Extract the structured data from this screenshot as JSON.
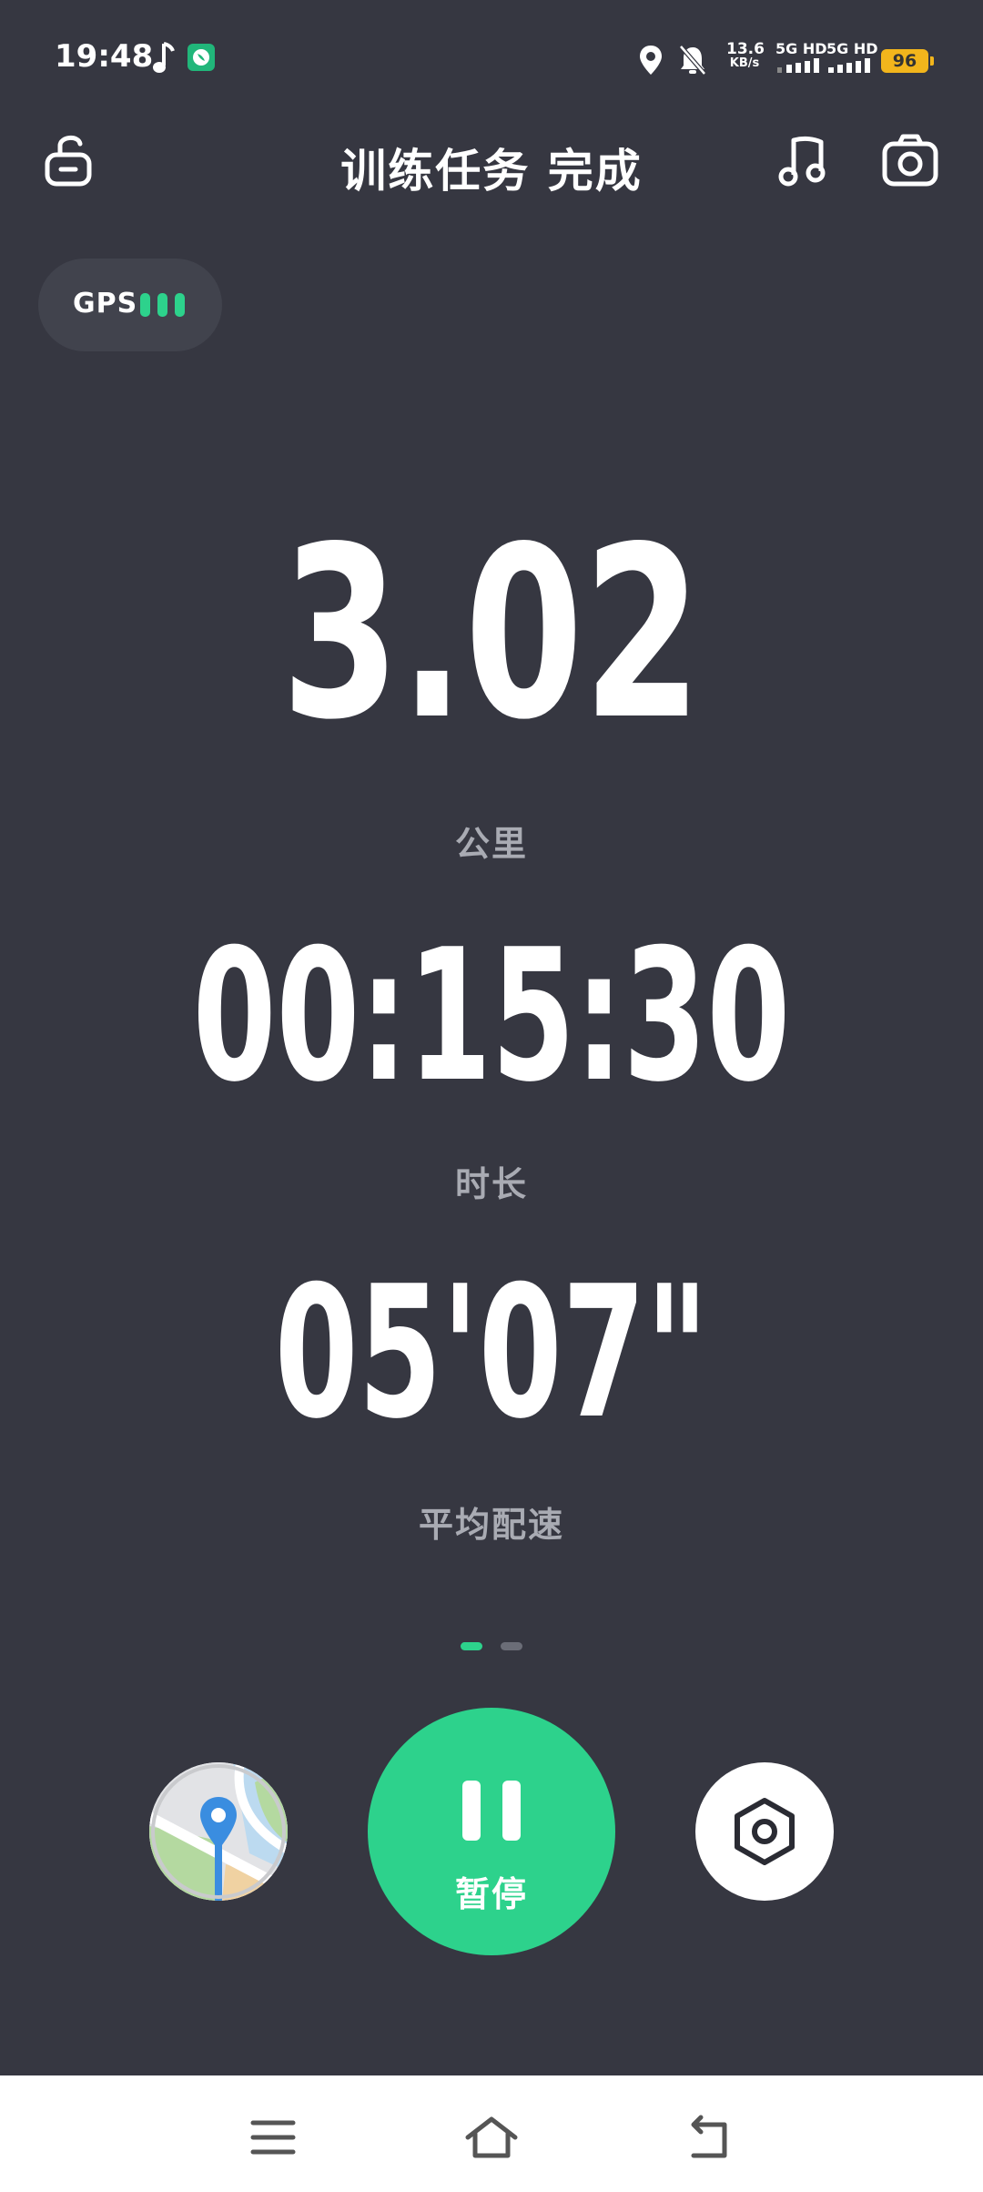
{
  "status_bar": {
    "time": "19:48",
    "net_speed_value": "13.6",
    "net_speed_unit": "KB/s",
    "sim1_label": "5G HD",
    "sim2_label": "5G HD",
    "battery_level": "96",
    "icons": [
      "music-note-icon",
      "app-notification-icon",
      "location-icon",
      "mute-bell-icon",
      "signal-icon",
      "signal-icon",
      "battery-icon"
    ]
  },
  "header": {
    "title": "训练任务 完成",
    "icons": [
      "unlock-icon",
      "music-icon",
      "camera-icon"
    ]
  },
  "gps": {
    "label": "GPS",
    "strength_bars": 3
  },
  "metrics": [
    {
      "value": "3.02",
      "label": "公里"
    },
    {
      "value": "00:15:30",
      "label": "时长"
    },
    {
      "value": "05'07\"",
      "label": "平均配速"
    }
  ],
  "pager": {
    "pages": 2,
    "active_index": 0
  },
  "controls": {
    "map_icon": "map-icon",
    "pause_label": "暂停",
    "settings_icon": "settings-icon"
  },
  "colors": {
    "background": "#363741",
    "accent": "#2dd28c",
    "label_gray": "#a9abb3",
    "battery": "#f2b51c"
  },
  "nav_bar": {
    "icons": [
      "menu-icon",
      "home-icon",
      "back-icon"
    ]
  }
}
